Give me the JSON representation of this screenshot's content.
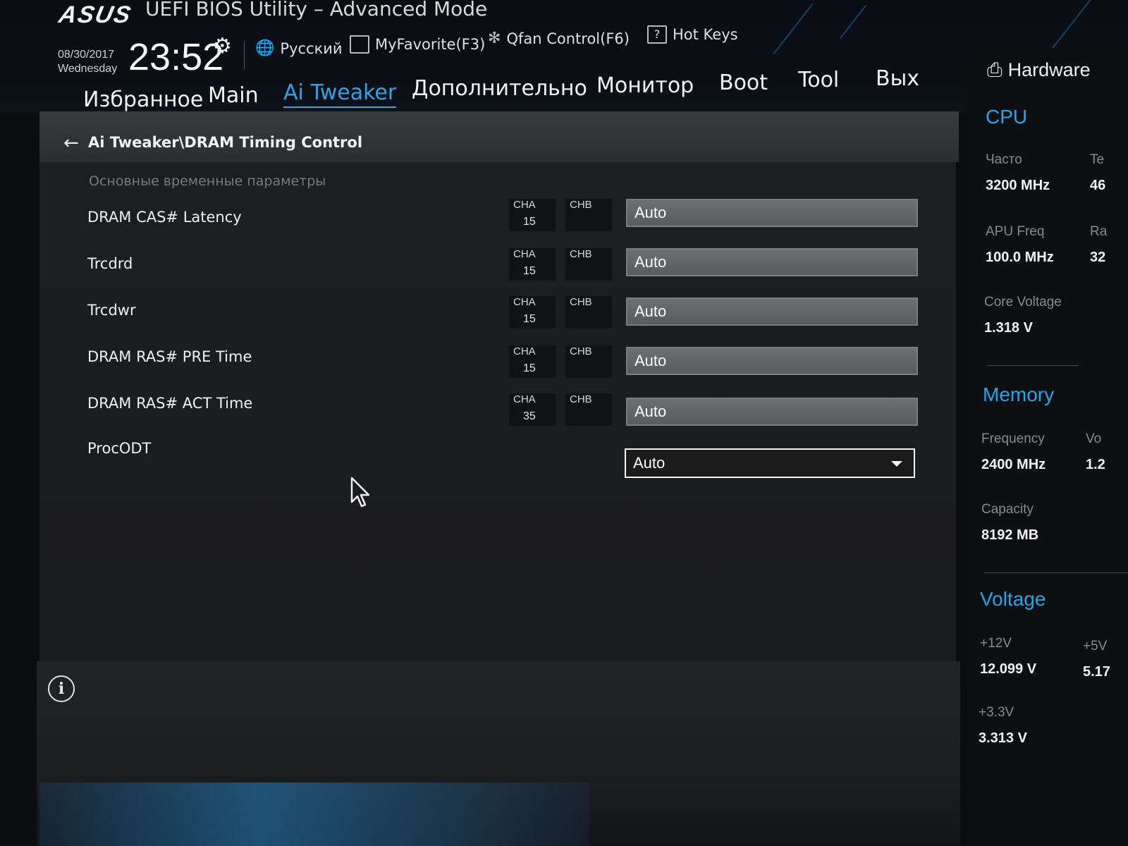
{
  "header": {
    "logo": "ASUS",
    "title": "UEFI BIOS Utility – Advanced Mode",
    "date": "08/30/2017",
    "weekday": "Wednesday",
    "time": "23:52",
    "tools": {
      "language": "Русский",
      "favorite": "MyFavorite(F3)",
      "qfan": "Qfan Control(F6)",
      "hotkeys": "Hot Keys"
    },
    "nav": [
      "Избранное",
      "Main",
      "Ai Tweaker",
      "Дополнительно",
      "Монитор",
      "Boot",
      "Tool",
      "Вых"
    ],
    "active_tab": "Ai Tweaker"
  },
  "breadcrumb": "Ai Tweaker\\DRAM Timing Control",
  "section_title": "Основные временные параметры",
  "timing_rows": [
    {
      "label": "DRAM CAS# Latency",
      "cha_label": "CHA",
      "chb_label": "CHB",
      "cha_value": "15",
      "value": "Auto"
    },
    {
      "label": "Trcdrd",
      "cha_label": "CHA",
      "chb_label": "CHB",
      "cha_value": "15",
      "value": "Auto"
    },
    {
      "label": "Trcdwr",
      "cha_label": "CHA",
      "chb_label": "CHB",
      "cha_value": "15",
      "value": "Auto"
    },
    {
      "label": "DRAM RAS# PRE Time",
      "cha_label": "CHA",
      "chb_label": "CHB",
      "cha_value": "15",
      "value": "Auto"
    },
    {
      "label": "DRAM RAS# ACT Time",
      "cha_label": "CHA",
      "chb_label": "CHB",
      "cha_value": "35",
      "value": "Auto"
    }
  ],
  "procodt": {
    "label": "ProcODT",
    "value": "Auto"
  },
  "hardware": {
    "title": "Hardware",
    "cpu": {
      "heading": "CPU",
      "freq_label": "Часто",
      "freq_value": "3200 MHz",
      "temp_label": "Te",
      "temp_value": "46",
      "apu_label": "APU Freq",
      "apu_value": "100.0 MHz",
      "ratio_label": "Ra",
      "ratio_value": "32",
      "core_voltage_label": "Core Voltage",
      "core_voltage_value": "1.318 V"
    },
    "memory": {
      "heading": "Memory",
      "freq_label": "Frequency",
      "freq_value": "2400 MHz",
      "volt_label": "Vo",
      "volt_value": "1.2",
      "capacity_label": "Capacity",
      "capacity_value": "8192 MB"
    },
    "voltage": {
      "heading": "Voltage",
      "v12_label": "+12V",
      "v12_value": "12.099 V",
      "v5_label": "+5V",
      "v5_value": "5.17",
      "v33_label": "+3.3V",
      "v33_value": "3.313 V"
    }
  },
  "colors": {
    "accent": "#2fa3e6",
    "panel": "#1d1e20",
    "field": "#626364"
  }
}
